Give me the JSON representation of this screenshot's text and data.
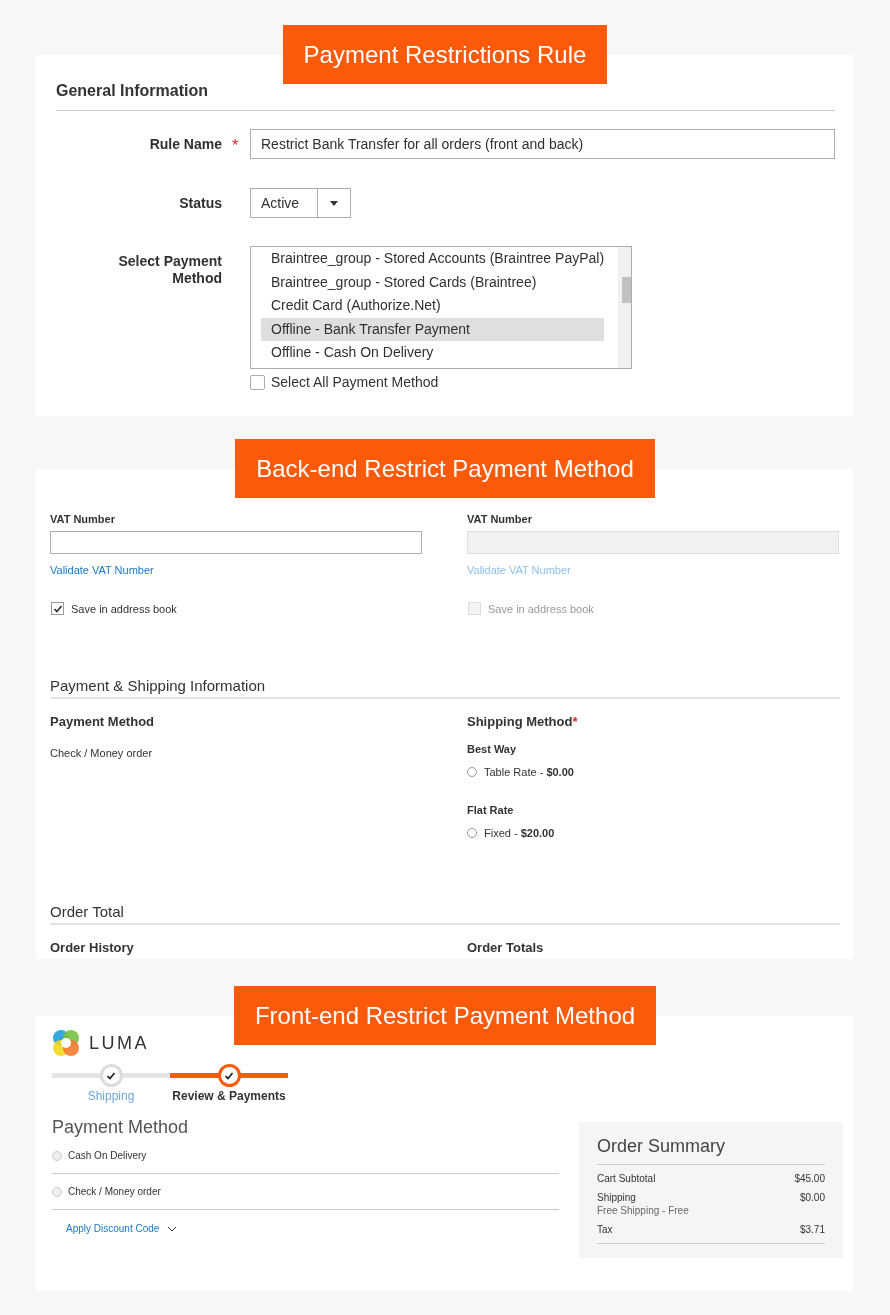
{
  "rule_section": {
    "banner": "Payment Restrictions Rule",
    "heading": "General Information",
    "rule_name": {
      "label": "Rule Name",
      "required_mark": "*",
      "value": "Restrict Bank Transfer for all orders (front and back)"
    },
    "status": {
      "label": "Status",
      "value": "Active"
    },
    "payment_methods": {
      "label": "Select Payment Method",
      "options": [
        {
          "label": "Braintree_group - Stored Accounts (Braintree PayPal)",
          "selected": false
        },
        {
          "label": "Braintree_group - Stored Cards (Braintree)",
          "selected": false
        },
        {
          "label": "Credit Card (Authorize.Net)",
          "selected": false
        },
        {
          "label": "Offline - Bank Transfer Payment",
          "selected": true
        },
        {
          "label": "Offline - Cash On Delivery",
          "selected": false
        }
      ],
      "select_all": {
        "label": "Select All Payment Method",
        "checked": false
      }
    }
  },
  "backend_section": {
    "banner": "Back-end Restrict Payment Method",
    "address_columns": [
      {
        "vat_label": "VAT Number",
        "disabled": false,
        "validate_link": "Validate VAT Number",
        "save_label": "Save in address book",
        "checked": true
      },
      {
        "vat_label": "VAT Number",
        "disabled": true,
        "validate_link": "Validate VAT Number",
        "save_label": "Save in address book",
        "checked": false
      }
    ],
    "payment_shipping_heading": "Payment & Shipping Information",
    "payment_method": {
      "title": "Payment Method",
      "value": "Check / Money order"
    },
    "shipping_method": {
      "title": "Shipping Method",
      "required_mark": "*",
      "groups": [
        {
          "name": "Best Way",
          "options": [
            {
              "label": "Table Rate - **$0.00**",
              "selected": false
            }
          ]
        },
        {
          "name": "Flat Rate",
          "options": [
            {
              "label": "Fixed - **$20.00**",
              "selected": false
            }
          ]
        }
      ]
    },
    "order_total_heading": "Order Total",
    "order_history": "Order History",
    "order_totals": "Order Totals"
  },
  "frontend_section": {
    "banner": "Front-end Restrict Payment Method",
    "logo": "LUMA",
    "steps": [
      {
        "label": "Shipping",
        "selected": false
      },
      {
        "label": "Review & Payments",
        "selected": true
      }
    ],
    "payment_heading": "Payment Method",
    "payment_options": [
      {
        "label": "Cash On Delivery",
        "selected": false
      },
      {
        "label": "Check / Money order",
        "selected": false
      }
    ],
    "discount_link": "Apply Discount Code",
    "summary": {
      "title": "Order Summary",
      "rows": [
        {
          "label": "Cart Subtotal",
          "value": "$45.00"
        },
        {
          "label": "Shipping",
          "note": "Free Shipping - Free",
          "value": "$0.00"
        },
        {
          "label": "Tax",
          "value": "$3.71"
        }
      ]
    }
  }
}
